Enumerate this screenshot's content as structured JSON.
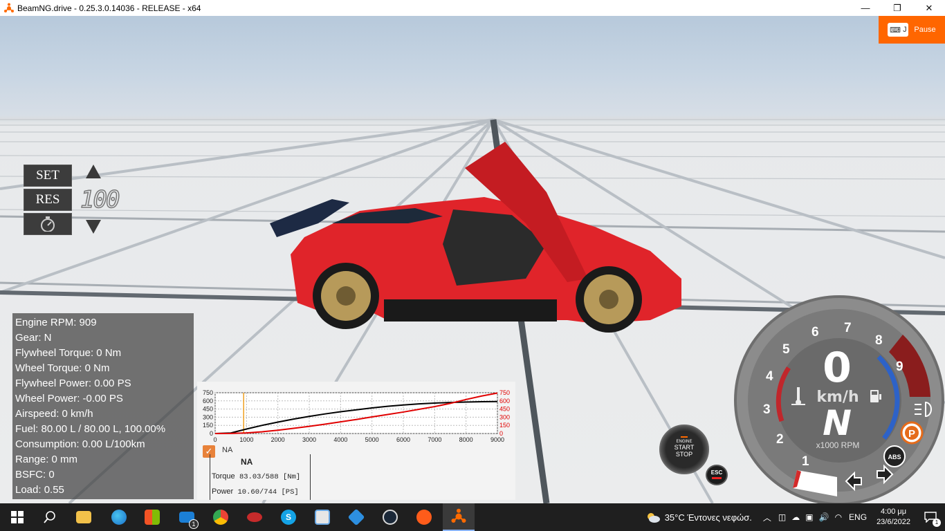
{
  "window": {
    "title": "BeamNG.drive - 0.25.3.0.14036 - RELEASE - x64",
    "minimize_glyph": "—",
    "maximize_glyph": "❐",
    "close_glyph": "✕"
  },
  "pause": {
    "key": "J",
    "label": "Pause",
    "color": "#ff6600"
  },
  "cruise_control": {
    "set_label": "SET",
    "res_label": "RES",
    "speed": "100",
    "up_icon": "triangle-up-icon",
    "down_icon": "triangle-down-icon",
    "gauge_icon": "speedometer-icon"
  },
  "debug": {
    "lines": [
      "Engine RPM: 909",
      "Gear: N",
      "Flywheel Torque: 0 Nm",
      "Wheel Torque: 0 Nm",
      "Flywheel Power: 0.00 PS",
      "Wheel Power: -0.00 PS",
      "Airspeed: 0 km/h",
      "Fuel: 80.00 L / 80.00 L, 100.00%",
      "Consumption: 0.00 L/100km",
      "Range: 0 mm",
      "BSFC: 0",
      "Load: 0.55"
    ]
  },
  "torque_curve": {
    "series_name": "NA",
    "table_header": "NA",
    "torque_label": "Torque",
    "torque_value": "83.03/588 [Nm]",
    "power_label": "Power",
    "power_value": "10.60/744 [PS]"
  },
  "chart_data": {
    "type": "line",
    "x_ticks": [
      "0",
      "1000",
      "2000",
      "3000",
      "4000",
      "5000",
      "6000",
      "7000",
      "8000",
      "9000"
    ],
    "y_left_ticks": [
      "750",
      "600",
      "450",
      "300",
      "150",
      "0"
    ],
    "y_right_ticks": [
      "750",
      "600",
      "450",
      "300",
      "150",
      "0"
    ],
    "xlim": [
      0,
      9000
    ],
    "ylim": [
      0,
      750
    ],
    "grid": true,
    "current_rpm": 909,
    "series": [
      {
        "color": "#000000",
        "x": [
          0,
          500,
          1000,
          1500,
          2000,
          2500,
          3000,
          3500,
          4000,
          4500,
          5000,
          5500,
          6000,
          6500,
          7000,
          7500,
          8000,
          8500,
          9000
        ],
        "values": [
          0,
          10,
          83,
          150,
          210,
          265,
          315,
          360,
          400,
          435,
          470,
          500,
          525,
          545,
          560,
          570,
          578,
          584,
          588
        ]
      },
      {
        "color": "#e00000",
        "x": [
          0,
          500,
          1000,
          1500,
          2000,
          2500,
          3000,
          3500,
          4000,
          4500,
          5000,
          5500,
          6000,
          6500,
          7000,
          7500,
          8000,
          8500,
          9000
        ],
        "values": [
          0,
          2,
          11,
          32,
          60,
          95,
          132,
          172,
          215,
          258,
          305,
          350,
          395,
          445,
          495,
          555,
          625,
          690,
          744
        ]
      }
    ]
  },
  "engine_button": {
    "line1": "ENGINE",
    "line2": "START",
    "line3": "STOP"
  },
  "esc_button": {
    "label": "ESC"
  },
  "dash": {
    "speed": "0",
    "speed_unit": "km/h",
    "gear": "N",
    "rpm_unit": "x1000 RPM",
    "rpm_marks": [
      "1",
      "2",
      "3",
      "4",
      "5",
      "6",
      "7",
      "8",
      "9"
    ],
    "abs_label": "ABS",
    "parking_label": "P",
    "fuel_icon": "fuel-pump-icon",
    "temp_icon": "coolant-temperature-icon",
    "headlight_icon": "headlight-icon",
    "left_signal_icon": "turn-left-icon",
    "right_signal_icon": "turn-right-icon"
  },
  "taskbar": {
    "apps": [
      "windows-start-icon",
      "search-icon",
      "file-explorer-icon",
      "edge-icon",
      "store-icon",
      "mail-icon",
      "chrome-icon",
      "app-icon-red",
      "skype-icon",
      "photo-icon",
      "maps-icon",
      "steam-icon",
      "app-icon-orange",
      "beamng-icon"
    ],
    "mail_badge": "1",
    "weather": "35°C  Έντονες νεφώσ.",
    "language": "ENG",
    "time": "4:00 μμ",
    "date": "23/6/2022",
    "notification_badge": "1"
  }
}
